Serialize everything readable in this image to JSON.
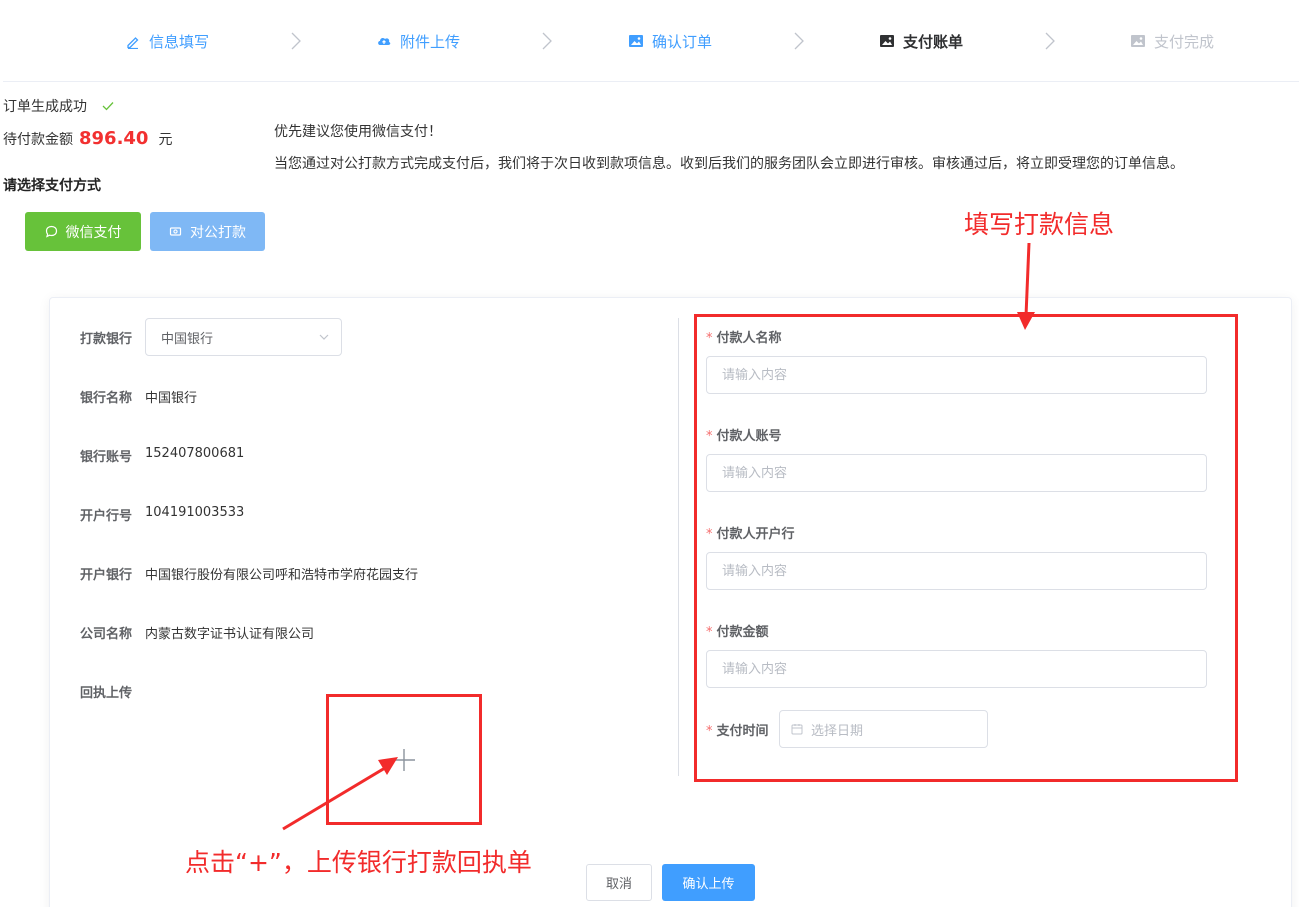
{
  "steps": [
    {
      "label": "信息填写",
      "icon": "pencil-icon",
      "state": "done"
    },
    {
      "label": "附件上传",
      "icon": "cloud-upload-icon",
      "state": "done"
    },
    {
      "label": "确认订单",
      "icon": "image-icon",
      "state": "done"
    },
    {
      "label": "支付账单",
      "icon": "image-icon",
      "state": "active"
    },
    {
      "label": "支付完成",
      "icon": "image-icon",
      "state": "pending"
    }
  ],
  "order": {
    "success_text": "订单生成成功",
    "amount_label": "待付款金额",
    "amount_value": "896.40",
    "amount_unit": "元",
    "choose_method": "请选择支付方式"
  },
  "notice": {
    "line1": "优先建议您使用微信支付！",
    "line2": "当您通过对公打款方式完成支付后，我们将于次日收到款项信息。收到后我们的服务团队会立即进行审核。审核通过后，将立即受理您的订单信息。"
  },
  "pay_methods": {
    "wechat": "微信支付",
    "corporate": "对公打款"
  },
  "bank_info": {
    "bank_label": "打款银行",
    "bank_selected": "中国银行",
    "bank_name_label": "银行名称",
    "bank_name": "中国银行",
    "account_label": "银行账号",
    "account": "152407800681",
    "branch_no_label": "开户行号",
    "branch_no": "104191003533",
    "branch_label": "开户银行",
    "branch": "中国银行股份有限公司呼和浩特市学府花园支行",
    "company_label": "公司名称",
    "company": "内蒙古数字证书认证有限公司",
    "receipt_label": "回执上传"
  },
  "form": {
    "payer_name_label": "付款人名称",
    "payer_account_label": "付款人账号",
    "payer_bank_label": "付款人开户行",
    "amount_label": "付款金额",
    "pay_time_label": "支付时间",
    "input_placeholder": "请输入内容",
    "date_placeholder": "选择日期",
    "required_mark": "*"
  },
  "actions": {
    "cancel": "取消",
    "confirm": "确认上传"
  },
  "annotations": {
    "top": "填写打款信息",
    "bottom": "点击“+”，上传银行打款回执单"
  },
  "colors": {
    "primary": "#409eff",
    "success": "#67c23a",
    "danger": "#f22b2b",
    "price": "#f23030"
  }
}
